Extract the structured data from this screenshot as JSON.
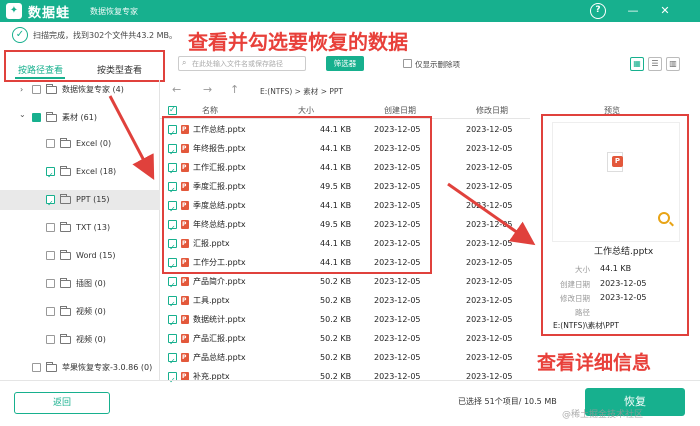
{
  "app": {
    "logo_char": "✦",
    "name": "数据蛙",
    "subtitle": "数据恢复专家"
  },
  "window_controls": [
    "?",
    "—",
    "✕"
  ],
  "status": {
    "icon": "check-circle-icon",
    "text": "扫描完成，找到302个文件共43.2 MB。"
  },
  "annotations": {
    "top": "查看并勾选要恢复的数据",
    "right": "查看详细信息"
  },
  "tabs": [
    {
      "label": "按路径查看",
      "active": true
    },
    {
      "label": "按类型查看",
      "active": false
    }
  ],
  "search": {
    "placeholder": "在此处输入文件名或保存路径"
  },
  "filter_button": "筛选器",
  "show_deleted_label": "仅显示删除项",
  "sidebar": {
    "items": [
      {
        "label": "数据恢复专家 (4)",
        "arrow": "›",
        "checked": false
      },
      {
        "label": "素材 (61)",
        "arrow": "⌄",
        "checked": "partial"
      },
      {
        "label": "Excel (0)",
        "checked": false
      },
      {
        "label": "Excel (18)",
        "checked": true
      },
      {
        "label": "PPT (15)",
        "checked": true,
        "selected": true
      },
      {
        "label": "TXT (13)",
        "checked": false
      },
      {
        "label": "Word (15)",
        "checked": false
      },
      {
        "label": "插图 (0)",
        "checked": false
      },
      {
        "label": "视频 (0)",
        "checked": false
      },
      {
        "label": "视频 (0)",
        "checked": false
      },
      {
        "label": "苹果恢复专家-3.0.86 (0)",
        "checked": false
      }
    ]
  },
  "breadcrumb": {
    "path": "E:(NTFS)  >  素材  >  PPT"
  },
  "table": {
    "headers": {
      "name": "名称",
      "size": "大小",
      "created": "创建日期",
      "modified": "修改日期"
    },
    "rows": [
      {
        "name": "工作总结.pptx",
        "size": "44.1 KB",
        "created": "2023-12-05",
        "modified": "2023-12-05",
        "checked": true
      },
      {
        "name": "年终报告.pptx",
        "size": "44.1 KB",
        "created": "2023-12-05",
        "modified": "2023-12-05",
        "checked": true
      },
      {
        "name": "工作汇报.pptx",
        "size": "44.1 KB",
        "created": "2023-12-05",
        "modified": "2023-12-05",
        "checked": true
      },
      {
        "name": "季度汇报.pptx",
        "size": "49.5 KB",
        "created": "2023-12-05",
        "modified": "2023-12-05",
        "checked": true
      },
      {
        "name": "季度总结.pptx",
        "size": "44.1 KB",
        "created": "2023-12-05",
        "modified": "2023-12-05",
        "checked": true
      },
      {
        "name": "年终总结.pptx",
        "size": "49.5 KB",
        "created": "2023-12-05",
        "modified": "2023-12-05",
        "checked": true
      },
      {
        "name": "汇报.pptx",
        "size": "44.1 KB",
        "created": "2023-12-05",
        "modified": "2023-12-05",
        "checked": true
      },
      {
        "name": "工作分工.pptx",
        "size": "44.1 KB",
        "created": "2023-12-05",
        "modified": "2023-12-05",
        "checked": true
      },
      {
        "name": "产品简介.pptx",
        "size": "50.2 KB",
        "created": "2023-12-05",
        "modified": "2023-12-05",
        "checked": true
      },
      {
        "name": "工具.pptx",
        "size": "50.2 KB",
        "created": "2023-12-05",
        "modified": "2023-12-05",
        "checked": true
      },
      {
        "name": "数据统计.pptx",
        "size": "50.2 KB",
        "created": "2023-12-05",
        "modified": "2023-12-05",
        "checked": true
      },
      {
        "name": "产品汇报.pptx",
        "size": "50.2 KB",
        "created": "2023-12-05",
        "modified": "2023-12-05",
        "checked": true
      },
      {
        "name": "产品总结.pptx",
        "size": "50.2 KB",
        "created": "2023-12-05",
        "modified": "2023-12-05",
        "checked": true
      },
      {
        "name": "补充.pptx",
        "size": "50.2 KB",
        "created": "2023-12-05",
        "modified": "2023-12-05",
        "checked": true
      }
    ]
  },
  "preview": {
    "label": "预览",
    "file_name": "工作总结.pptx",
    "details": [
      {
        "key": "大小",
        "value": "44.1 KB"
      },
      {
        "key": "创建日期",
        "value": "2023-12-05"
      },
      {
        "key": "修改日期",
        "value": "2023-12-05"
      },
      {
        "key": "路径",
        "value": ""
      }
    ],
    "path": "E:(NTFS)\\素材\\PPT"
  },
  "footer": {
    "back_label": "返回",
    "selected_info": "已选择 51个项目/ 10.5 MB",
    "restore_label": "恢复",
    "watermark": "@稀土掘金技术社区"
  },
  "colors": {
    "accent": "#17b08e",
    "annotation": "#e0413c"
  }
}
